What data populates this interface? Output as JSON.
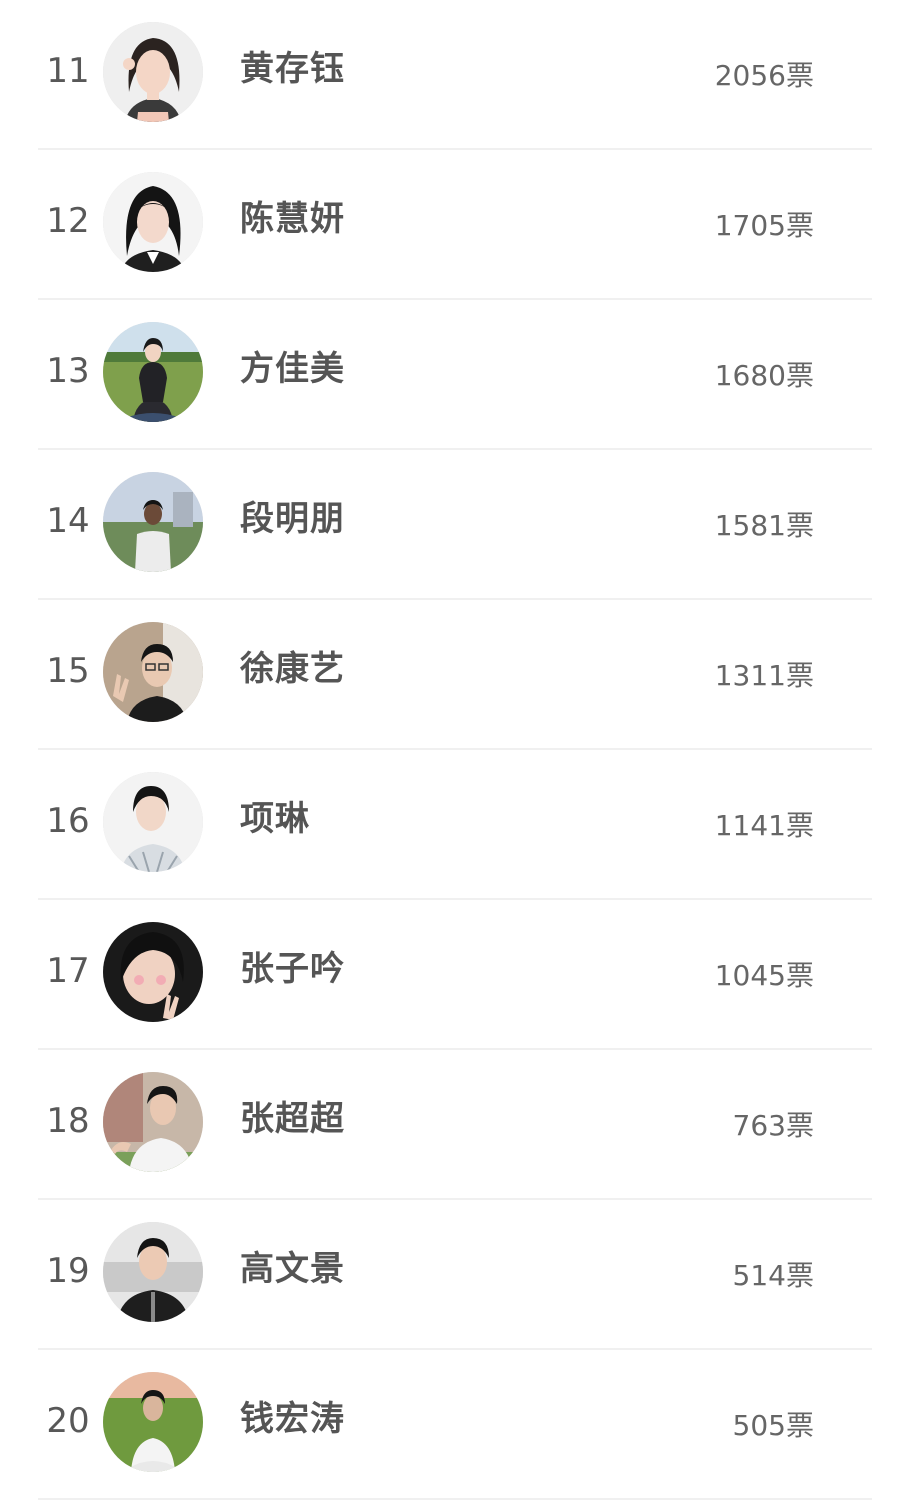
{
  "ranking": {
    "vote_unit": "票",
    "entries": [
      {
        "rank": "11",
        "name": "黄存钰",
        "votes": "2056票",
        "avatar": "avatar-photo"
      },
      {
        "rank": "12",
        "name": "陈慧妍",
        "votes": "1705票",
        "avatar": "avatar-photo"
      },
      {
        "rank": "13",
        "name": "方佳美",
        "votes": "1680票",
        "avatar": "avatar-photo"
      },
      {
        "rank": "14",
        "name": "段明朋",
        "votes": "1581票",
        "avatar": "avatar-photo"
      },
      {
        "rank": "15",
        "name": "徐康艺",
        "votes": "1311票",
        "avatar": "avatar-photo"
      },
      {
        "rank": "16",
        "name": "项琳",
        "votes": "1141票",
        "avatar": "avatar-photo"
      },
      {
        "rank": "17",
        "name": "张子吟",
        "votes": "1045票",
        "avatar": "avatar-photo"
      },
      {
        "rank": "18",
        "name": "张超超",
        "votes": "763票",
        "avatar": "avatar-photo"
      },
      {
        "rank": "19",
        "name": "高文景",
        "votes": "514票",
        "avatar": "avatar-photo"
      },
      {
        "rank": "20",
        "name": "钱宏涛",
        "votes": "505票",
        "avatar": "avatar-photo"
      }
    ]
  },
  "colors": {
    "rank_text": "#585858",
    "name_text": "#555555",
    "votes_text": "#666666",
    "divider": "#f0f0f0",
    "background": "#ffffff"
  }
}
